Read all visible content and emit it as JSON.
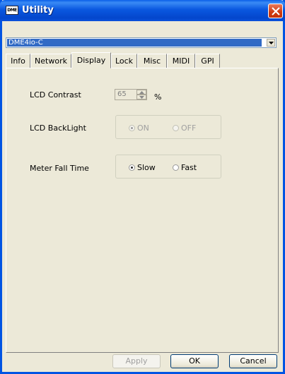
{
  "window": {
    "title": "Utility",
    "app_icon_text": "DME"
  },
  "device_select": {
    "value": "DME4io-C"
  },
  "tabs": [
    {
      "label": "Info"
    },
    {
      "label": "Network"
    },
    {
      "label": "Display",
      "active": true
    },
    {
      "label": "Lock"
    },
    {
      "label": "Misc"
    },
    {
      "label": "MIDI"
    },
    {
      "label": "GPI"
    }
  ],
  "display": {
    "lcd_contrast": {
      "label": "LCD Contrast",
      "value": "65",
      "unit": "%"
    },
    "lcd_backlight": {
      "label": "LCD BackLight",
      "options": [
        "ON",
        "OFF"
      ],
      "selected": "ON",
      "enabled": false
    },
    "meter_fall_time": {
      "label": "Meter Fall Time",
      "options": [
        "Slow",
        "Fast"
      ],
      "selected": "Slow",
      "enabled": true
    }
  },
  "buttons": {
    "apply": "Apply",
    "ok": "OK",
    "cancel": "Cancel"
  },
  "colors": {
    "titlebar": "#0a58e0",
    "face": "#ece9d8",
    "selection": "#316ac5",
    "close": "#cf3a10"
  }
}
